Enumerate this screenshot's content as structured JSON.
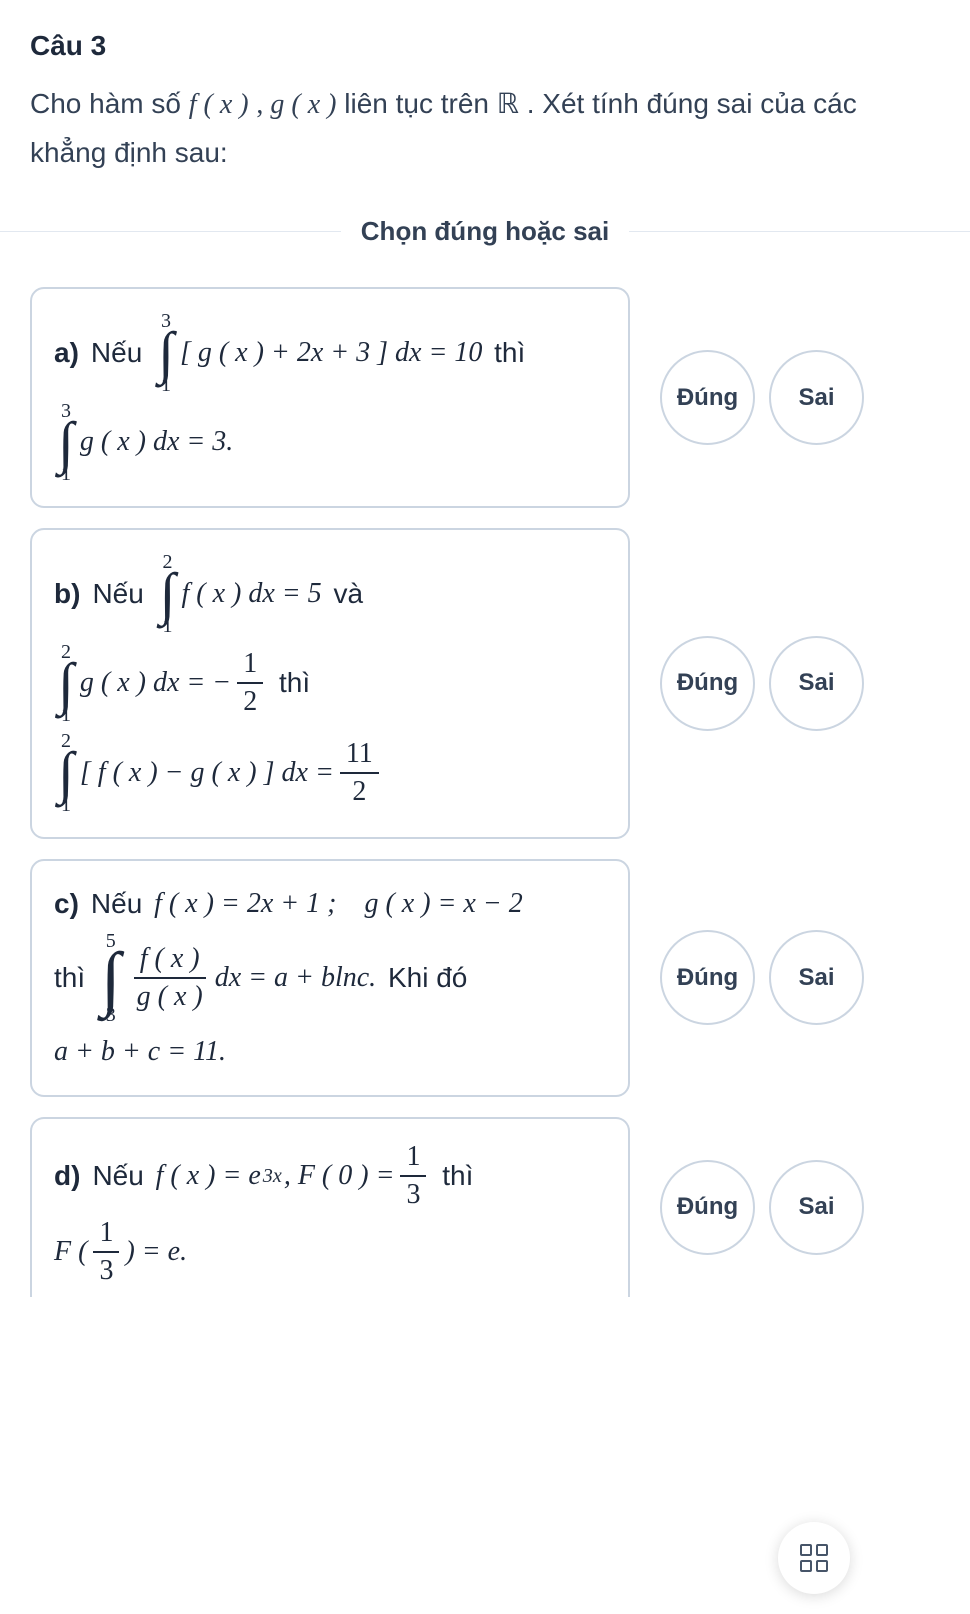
{
  "question": {
    "title": "Câu 3",
    "text_part1": "Cho hàm số ",
    "text_part2": " liên tục trên ",
    "text_part3": ". Xét tính đúng sai của các khẳng định sau:"
  },
  "divider": "Chọn đúng hoặc sai",
  "buttons": {
    "true": "Đúng",
    "false": "Sai"
  },
  "items": {
    "a": {
      "label": "a)",
      "neu": "Nếu",
      "thi": "thì"
    },
    "b": {
      "label": "b)",
      "neu": "Nếu",
      "va": "và",
      "thi": "thì"
    },
    "c": {
      "label": "c)",
      "neu": "Nếu",
      "thi": "thì",
      "khido": "Khi đó"
    },
    "d": {
      "label": "d)",
      "neu": "Nếu",
      "thi": "thì"
    }
  },
  "math": {
    "fx": "f ( x )",
    "gx": "g ( x )",
    "comma": " , ",
    "R": "ℝ",
    "a_int1": {
      "ub": "3",
      "lb": "1",
      "body": "[ g ( x ) + 2x + 3 ] dx = 10"
    },
    "a_int2": {
      "ub": "3",
      "lb": "1",
      "body": "g ( x ) dx = 3."
    },
    "b_int1": {
      "ub": "2",
      "lb": "1",
      "body": "f ( x ) dx = 5"
    },
    "b_int2": {
      "ub": "2",
      "lb": "1",
      "body_pre": "g ( x ) dx = −",
      "frac_n": "1",
      "frac_d": "2"
    },
    "b_int3": {
      "ub": "2",
      "lb": "1",
      "body_pre": "[ f ( x ) − g ( x ) ] dx =",
      "frac_n": "11",
      "frac_d": "2"
    },
    "c_eq1": "f ( x ) = 2x + 1 ; g ( x ) = x − 2",
    "c_int": {
      "ub": "5",
      "lb": "3",
      "frac_n": "f ( x )",
      "frac_d": "g ( x )",
      "after": "dx = a + blnc."
    },
    "c_eq2": "a + b + c = 11.",
    "d_eq1_pre": "f ( x ) = e",
    "d_eq1_sup": "3x",
    "d_eq1_mid": ", F ( 0 ) =",
    "d_frac1_n": "1",
    "d_frac1_d": "3",
    "d_eq2_pre": "F (",
    "d_frac2_n": "1",
    "d_frac2_d": "3",
    "d_eq2_post": ") = e."
  }
}
